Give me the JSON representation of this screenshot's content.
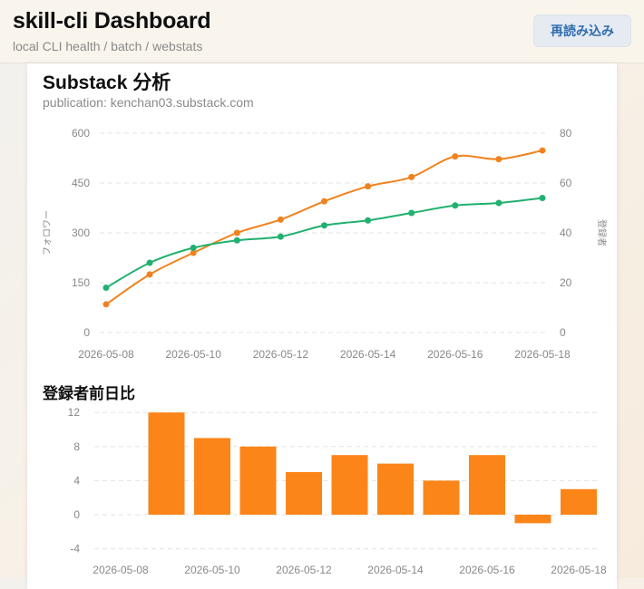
{
  "app": {
    "title": "skill-cli Dashboard",
    "subtitle": "local CLI health / batch / webstats",
    "reload_label": "再読み込み"
  },
  "panel": {
    "title": "Substack 分析",
    "publication": "publication: kenchan03.substack.com"
  },
  "colors": {
    "followers": "#f0821e",
    "subscribers": "#21b06f",
    "bars": "#fb8518"
  },
  "chart_data": [
    {
      "type": "line",
      "x": [
        "2026-05-08",
        "2026-05-09",
        "2026-05-10",
        "2026-05-11",
        "2026-05-12",
        "2026-05-13",
        "2026-05-14",
        "2026-05-15",
        "2026-05-16",
        "2026-05-17",
        "2026-05-18"
      ],
      "x_tick_labels": [
        "2026-05-08",
        "2026-05-10",
        "2026-05-12",
        "2026-05-14",
        "2026-05-16",
        "2026-05-18"
      ],
      "ylabel_left": "フォロワー",
      "ylabel_right": "登録者",
      "ylim_left": [
        0,
        600
      ],
      "ylim_right": [
        0,
        80
      ],
      "yticks_left": [
        0,
        150,
        300,
        450,
        600
      ],
      "yticks_right": [
        0,
        20,
        40,
        60,
        80
      ],
      "grid": "horizontal dashed",
      "series": [
        {
          "axis": "left",
          "color": "#f0821e",
          "values": [
            85,
            175,
            240,
            300,
            340,
            395,
            440,
            468,
            530,
            522,
            548
          ]
        },
        {
          "axis": "right",
          "color": "#21b06f",
          "values": [
            18,
            28,
            34,
            37,
            38.5,
            43,
            45,
            48,
            51,
            52,
            54
          ]
        }
      ]
    },
    {
      "type": "bar",
      "title": "登録者前日比",
      "categories": [
        "2026-05-08",
        "2026-05-09",
        "2026-05-10",
        "2026-05-11",
        "2026-05-12",
        "2026-05-13",
        "2026-05-14",
        "2026-05-15",
        "2026-05-16",
        "2026-05-17",
        "2026-05-18"
      ],
      "x_tick_labels": [
        "2026-05-08",
        "2026-05-10",
        "2026-05-12",
        "2026-05-14",
        "2026-05-16",
        "2026-05-18"
      ],
      "values": [
        null,
        12,
        9,
        8,
        5,
        7,
        6,
        4,
        7,
        -1,
        3
      ],
      "ylim": [
        -4,
        13
      ],
      "yticks": [
        -4,
        0,
        4,
        8,
        12
      ],
      "color": "#fb8518",
      "grid": "horizontal dashed"
    }
  ]
}
